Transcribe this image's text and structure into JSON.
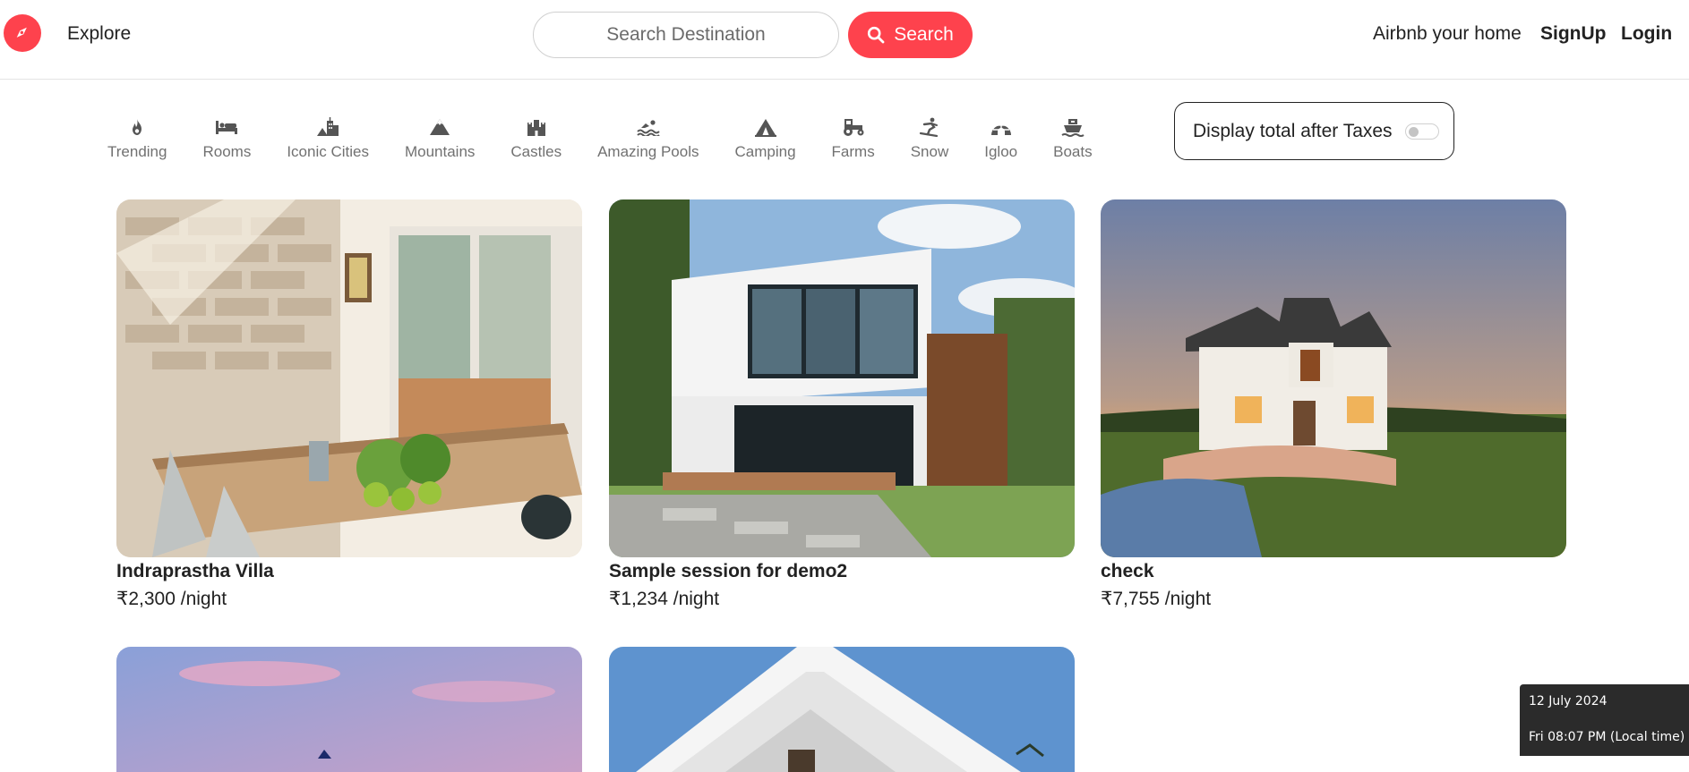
{
  "navbar": {
    "explore": "Explore",
    "search_placeholder": "Search Destination",
    "search_button": "Search",
    "host_link": "Airbnb your home",
    "signup": "SignUp",
    "login": "Login",
    "logo_icon": "compass-icon",
    "brand_color": "#fe424d"
  },
  "filters": [
    {
      "label": "Trending",
      "icon": "fire-icon"
    },
    {
      "label": "Rooms",
      "icon": "bed-icon"
    },
    {
      "label": "Iconic Cities",
      "icon": "city-icon"
    },
    {
      "label": "Mountains",
      "icon": "mountain-icon"
    },
    {
      "label": "Castles",
      "icon": "castle-icon"
    },
    {
      "label": "Amazing Pools",
      "icon": "swimmer-icon"
    },
    {
      "label": "Camping",
      "icon": "tent-icon"
    },
    {
      "label": "Farms",
      "icon": "tractor-icon"
    },
    {
      "label": "Snow",
      "icon": "snowboarder-icon"
    },
    {
      "label": "Igloo",
      "icon": "igloo-icon"
    },
    {
      "label": "Boats",
      "icon": "ship-icon"
    }
  ],
  "tax_toggle": {
    "label": "Display total after Taxes",
    "enabled": false
  },
  "listings": [
    {
      "title": "Indraprastha Villa",
      "price": "₹2,300 /night"
    },
    {
      "title": "Sample session for demo2",
      "price": "₹1,234 /night"
    },
    {
      "title": "check",
      "price": "₹7,755 /night"
    }
  ],
  "clock": {
    "date": "12 July 2024",
    "time": "Fri 08:07 PM (Local time)"
  }
}
